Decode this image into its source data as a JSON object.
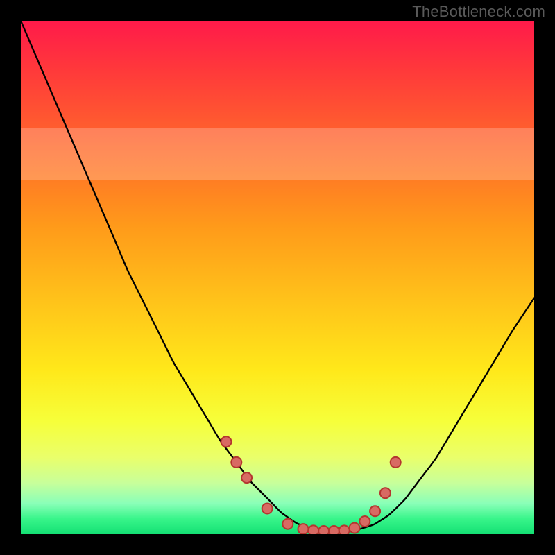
{
  "watermark": "TheBottleneck.com",
  "colors": {
    "frame_bg": "#000000",
    "curve_stroke": "#000000",
    "dot_stroke": "#b4362f",
    "dot_fill": "#d86a63",
    "gradient_stops": [
      "#ff1a4a",
      "#ff3a3a",
      "#ff6a2a",
      "#ff9a1a",
      "#ffc41a",
      "#ffe81a",
      "#f6ff3a",
      "#eaff6a",
      "#c8ff9a",
      "#8affb8",
      "#38f58a",
      "#14e074"
    ]
  },
  "chart_data": {
    "type": "line",
    "title": "",
    "xlabel": "",
    "ylabel": "",
    "xlim": [
      0,
      100
    ],
    "ylim": [
      0,
      100
    ],
    "series": [
      {
        "name": "bottleneck-curve",
        "x": [
          0,
          3,
          6,
          9,
          12,
          15,
          18,
          21,
          24,
          27,
          30,
          33,
          36,
          39,
          42,
          45,
          48,
          51,
          54,
          57,
          60,
          63,
          66,
          69,
          72,
          75,
          78,
          81,
          84,
          87,
          90,
          93,
          96,
          100
        ],
        "y": [
          100,
          93,
          86,
          79,
          72,
          65,
          58,
          51,
          45,
          39,
          33,
          28,
          23,
          18,
          14,
          10,
          7,
          4,
          2,
          1,
          0.5,
          0.5,
          1,
          2,
          4,
          7,
          11,
          15,
          20,
          25,
          30,
          35,
          40,
          46
        ]
      }
    ],
    "highlight_points": {
      "name": "optimal-range-dots",
      "x": [
        40,
        42,
        44,
        48,
        52,
        55,
        57,
        59,
        61,
        63,
        65,
        67,
        69,
        71,
        73
      ],
      "y": [
        18,
        14,
        11,
        5,
        2,
        1,
        0.7,
        0.6,
        0.6,
        0.7,
        1.2,
        2.5,
        4.5,
        8,
        14
      ]
    },
    "pale_band_y_range": [
      69,
      79
    ]
  }
}
